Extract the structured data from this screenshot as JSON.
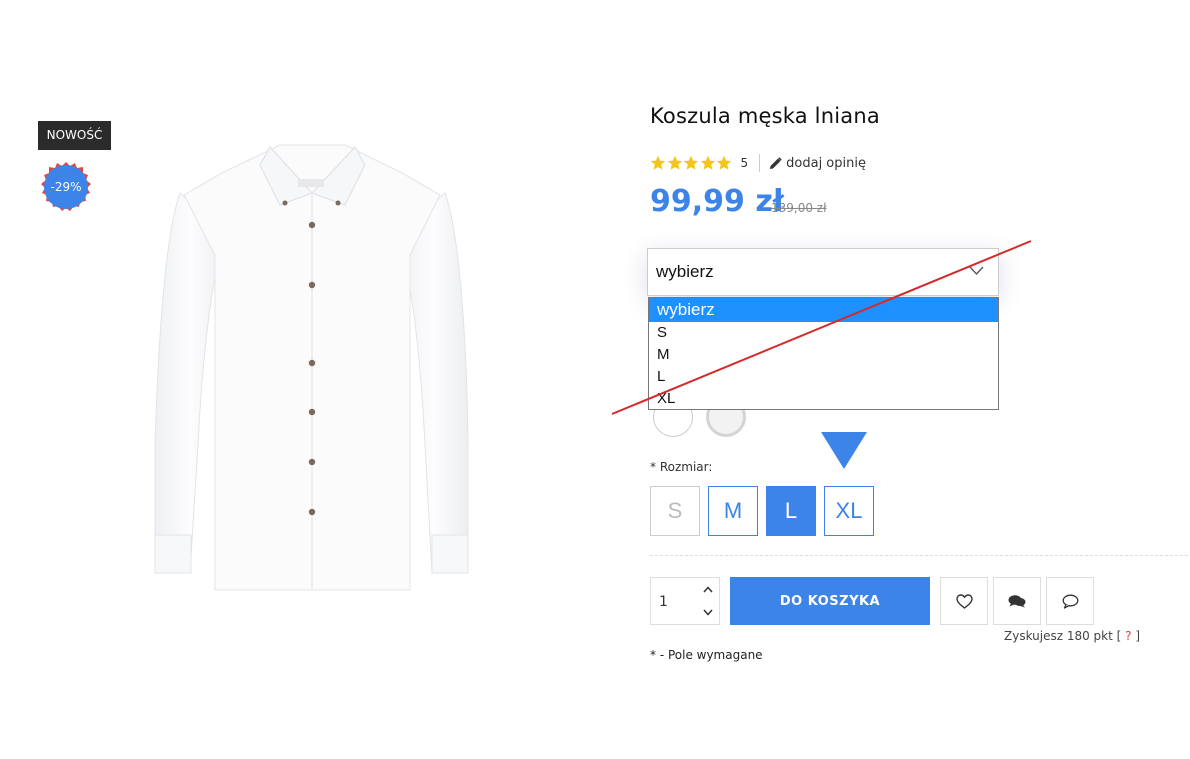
{
  "badges": {
    "new": "NOWOŚĆ",
    "discount": "-29%"
  },
  "product": {
    "title": "Koszula męska lniana",
    "rating": {
      "stars": 5,
      "max": 5,
      "count": "5",
      "review_link": "dodaj opinię"
    },
    "price": "99,99 zł",
    "old_price": "139,00 zł"
  },
  "variant_select": {
    "value": "wybierz",
    "options": [
      "wybierz",
      "S",
      "M",
      "L",
      "XL"
    ],
    "selected_index": 0
  },
  "sizes": {
    "label": "* Rozmiar:",
    "options": [
      {
        "label": "S",
        "state": "disabled"
      },
      {
        "label": "M",
        "state": "normal"
      },
      {
        "label": "L",
        "state": "active"
      },
      {
        "label": "XL",
        "state": "normal"
      }
    ]
  },
  "cart": {
    "quantity": "1",
    "add_button": "DO KOSZYKA",
    "points_text": "Zyskujesz 180 pkt [",
    "points_help": "?",
    "points_close": "]",
    "required_note": "* - Pole wymagane"
  },
  "icons": {
    "wishlist": "heart-icon",
    "ask": "chat-bubbles-icon",
    "comment": "comment-icon",
    "review": "pencil-icon"
  },
  "colors": {
    "accent": "#3d84e8",
    "badge_dark": "#2b2b2b",
    "annotation": "#d42a2a",
    "star": "#f5c518",
    "dropdown_highlight": "#1e90ff"
  }
}
